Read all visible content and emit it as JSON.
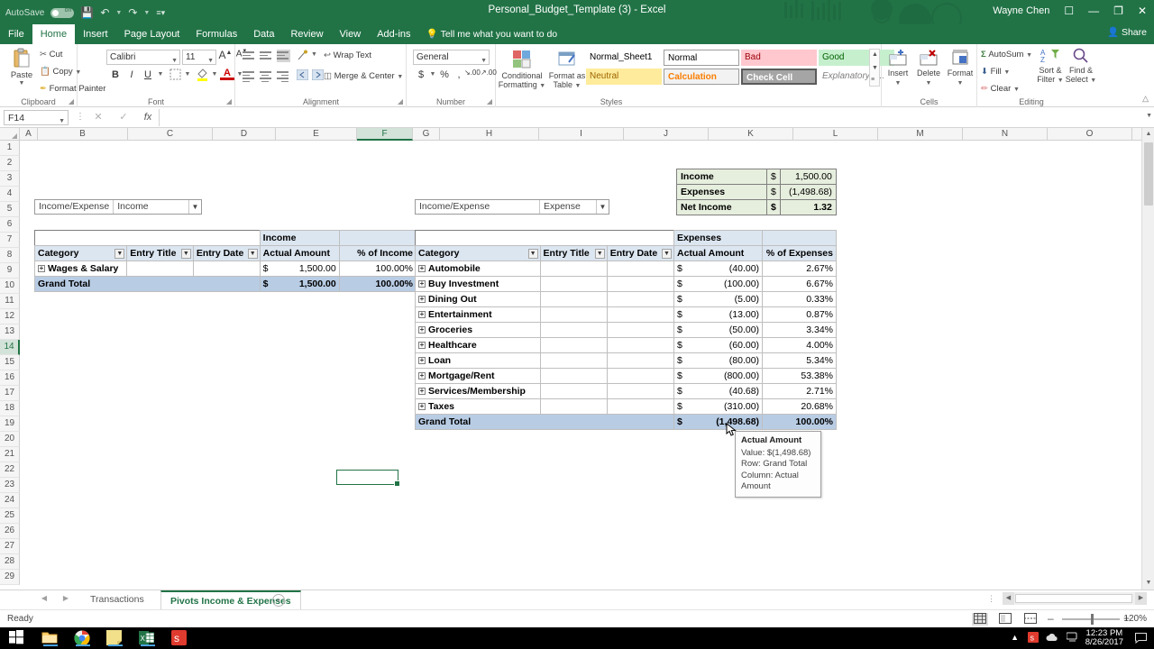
{
  "titlebar": {
    "autosave_label": "AutoSave",
    "autosave_state": "on",
    "save_icon": "save-icon",
    "undo_icon": "undo-icon",
    "redo_icon": "redo-icon",
    "qat_more_icon": "customize-qat-icon",
    "document_title": "Personal_Budget_Template (3)  -  Excel",
    "user_name": "Wayne Chen",
    "ribbon_display_icon": "ribbon-display-options-icon",
    "minimize": "—",
    "restore": "❐",
    "close": "✕",
    "share_label": "Share",
    "share_icon": "share-person-icon"
  },
  "ribbon_tabs": [
    {
      "label": "File",
      "active": false
    },
    {
      "label": "Home",
      "active": true
    },
    {
      "label": "Insert",
      "active": false
    },
    {
      "label": "Page Layout",
      "active": false
    },
    {
      "label": "Formulas",
      "active": false
    },
    {
      "label": "Data",
      "active": false
    },
    {
      "label": "Review",
      "active": false
    },
    {
      "label": "View",
      "active": false
    },
    {
      "label": "Add-ins",
      "active": false
    }
  ],
  "tellme": "Tell me what you want to do",
  "ribbon": {
    "clipboard": {
      "name": "Clipboard",
      "paste": "Paste",
      "cut": "Cut",
      "copy": "Copy",
      "format_painter": "Format Painter"
    },
    "font": {
      "name": "Font",
      "font_family": "Calibri",
      "font_size": "11",
      "grow_font": "A",
      "shrink_font": "A",
      "bold": "B",
      "italic": "I",
      "underline": "U"
    },
    "alignment": {
      "name": "Alignment",
      "wrap_text": "Wrap Text",
      "merge_center": "Merge & Center"
    },
    "number": {
      "name": "Number",
      "format": "General",
      "currency": "$",
      "percent": "%",
      "comma": ","
    },
    "styles": {
      "name": "Styles",
      "conditional_formatting": "Conditional Formatting",
      "format_as_table": "Format as Table",
      "cell_styles": [
        {
          "label": "Normal_Sheet1",
          "bg": "#ffffff",
          "fg": "#222222",
          "border": "#ffffff"
        },
        {
          "label": "Normal",
          "bg": "#ffffff",
          "fg": "#222222",
          "border": "#9c9c9c"
        },
        {
          "label": "Bad",
          "bg": "#ffc7ce",
          "fg": "#9c0006",
          "border": "#ffc7ce"
        },
        {
          "label": "Good",
          "bg": "#c6efce",
          "fg": "#006100",
          "border": "#c6efce"
        },
        {
          "label": "Neutral",
          "bg": "#ffeb9c",
          "fg": "#9c6500",
          "border": "#ffeb9c"
        },
        {
          "label": "Calculation",
          "bg": "#f2f2f2",
          "fg": "#fa7d00",
          "border": "#9c9c9c"
        },
        {
          "label": "Check Cell",
          "bg": "#a5a5a5",
          "fg": "#ffffff",
          "border": "#5a5a5a"
        },
        {
          "label": "Explanatory T...",
          "bg": "#ffffff",
          "fg": "#7f7f7f",
          "border": "#ffffff"
        }
      ]
    },
    "cells": {
      "name": "Cells",
      "insert": "Insert",
      "delete": "Delete",
      "format": "Format"
    },
    "editing": {
      "name": "Editing",
      "autosum": "AutoSum",
      "fill": "Fill",
      "clear": "Clear",
      "sort_filter": "Sort & Filter",
      "find_select": "Find & Select"
    }
  },
  "formula_bar": {
    "name_box": "F14",
    "cancel_icon": "cancel-icon",
    "enter_icon": "confirm-check-icon",
    "function_icon": "insert-function-icon",
    "formula_value": ""
  },
  "grid": {
    "columns": [
      "A",
      "B",
      "C",
      "D",
      "E",
      "F",
      "G",
      "H",
      "I",
      "J",
      "K",
      "L",
      "M",
      "N",
      "O",
      "P"
    ],
    "selected_column": "F",
    "rows": [
      1,
      2,
      3,
      4,
      5,
      6,
      7,
      8,
      9,
      10,
      11,
      12,
      13,
      14,
      15,
      16,
      17,
      18,
      19,
      20,
      21,
      22,
      23,
      24,
      25,
      26,
      27,
      28,
      29
    ],
    "selected_row": 14,
    "selected_cell": "F14"
  },
  "slicers": [
    {
      "label": "Income/Expense",
      "value": "Income",
      "filter_icon": "filter-applied-icon"
    },
    {
      "label": "Income/Expense",
      "value": "Expense",
      "filter_icon": "filter-applied-icon"
    }
  ],
  "summary_box": {
    "rows": [
      {
        "label": "Income",
        "currency": "$",
        "value": "1,500.00"
      },
      {
        "label": "Expenses",
        "currency": "$",
        "value": "(1,498.68)"
      },
      {
        "label": "Net Income",
        "currency": "$",
        "value": "1.32"
      }
    ]
  },
  "income_pivot": {
    "band_label": "Income",
    "headers": [
      "Category",
      "Entry Title",
      "Entry Date",
      "Actual Amount",
      "% of Income"
    ],
    "rows": [
      {
        "category": "Wages & Salary",
        "entry_title": "",
        "entry_date": "",
        "currency": "$",
        "amount": "1,500.00",
        "percent": "100.00%"
      }
    ],
    "grand_total": {
      "label": "Grand Total",
      "currency": "$",
      "amount": "1,500.00",
      "percent": "100.00%"
    }
  },
  "expense_pivot": {
    "band_label": "Expenses",
    "headers": [
      "Category",
      "Entry Title",
      "Entry Date",
      "Actual Amount",
      "% of Expenses"
    ],
    "rows": [
      {
        "category": "Automobile",
        "currency": "$",
        "amount": "(40.00)",
        "percent": "2.67%"
      },
      {
        "category": "Buy Investment",
        "currency": "$",
        "amount": "(100.00)",
        "percent": "6.67%"
      },
      {
        "category": "Dining Out",
        "currency": "$",
        "amount": "(5.00)",
        "percent": "0.33%"
      },
      {
        "category": "Entertainment",
        "currency": "$",
        "amount": "(13.00)",
        "percent": "0.87%"
      },
      {
        "category": "Groceries",
        "currency": "$",
        "amount": "(50.00)",
        "percent": "3.34%"
      },
      {
        "category": "Healthcare",
        "currency": "$",
        "amount": "(60.00)",
        "percent": "4.00%"
      },
      {
        "category": "Loan",
        "currency": "$",
        "amount": "(80.00)",
        "percent": "5.34%"
      },
      {
        "category": "Mortgage/Rent",
        "currency": "$",
        "amount": "(800.00)",
        "percent": "53.38%"
      },
      {
        "category": "Services/Membership",
        "currency": "$",
        "amount": "(40.68)",
        "percent": "2.71%"
      },
      {
        "category": "Taxes",
        "currency": "$",
        "amount": "(310.00)",
        "percent": "20.68%"
      }
    ],
    "grand_total": {
      "label": "Grand Total",
      "currency": "$",
      "amount": "(1,498.68)",
      "percent": "100.00%"
    }
  },
  "tooltip": {
    "title": "Actual Amount",
    "value_line": "Value:  $(1,498.68)",
    "row_line": "Row: Grand Total",
    "column_line": "Column: Actual Amount"
  },
  "sheet_tabs": [
    {
      "label": "Transactions",
      "active": false
    },
    {
      "label": "Pivots Income & Expenses",
      "active": true
    }
  ],
  "add_sheet_label": "+",
  "status_bar": {
    "status": "Ready",
    "view_normal": "normal-view-icon",
    "view_page_layout": "page-layout-view-icon",
    "view_page_break": "page-break-view-icon",
    "zoom_out": "–",
    "zoom_in": "+",
    "zoom_level": "120%"
  },
  "taskbar": {
    "start": "start-icon",
    "items": [
      "file-explorer-icon",
      "chrome-icon",
      "sticky-notes-icon",
      "excel-icon",
      "snagit-icon"
    ],
    "tray": [
      "show-hidden-icons-icon",
      "snagit-tray-icon",
      "onedrive-icon",
      "network-icon"
    ],
    "time": "12:23 PM",
    "date": "8/26/2017",
    "action_center": "action-center-icon"
  }
}
